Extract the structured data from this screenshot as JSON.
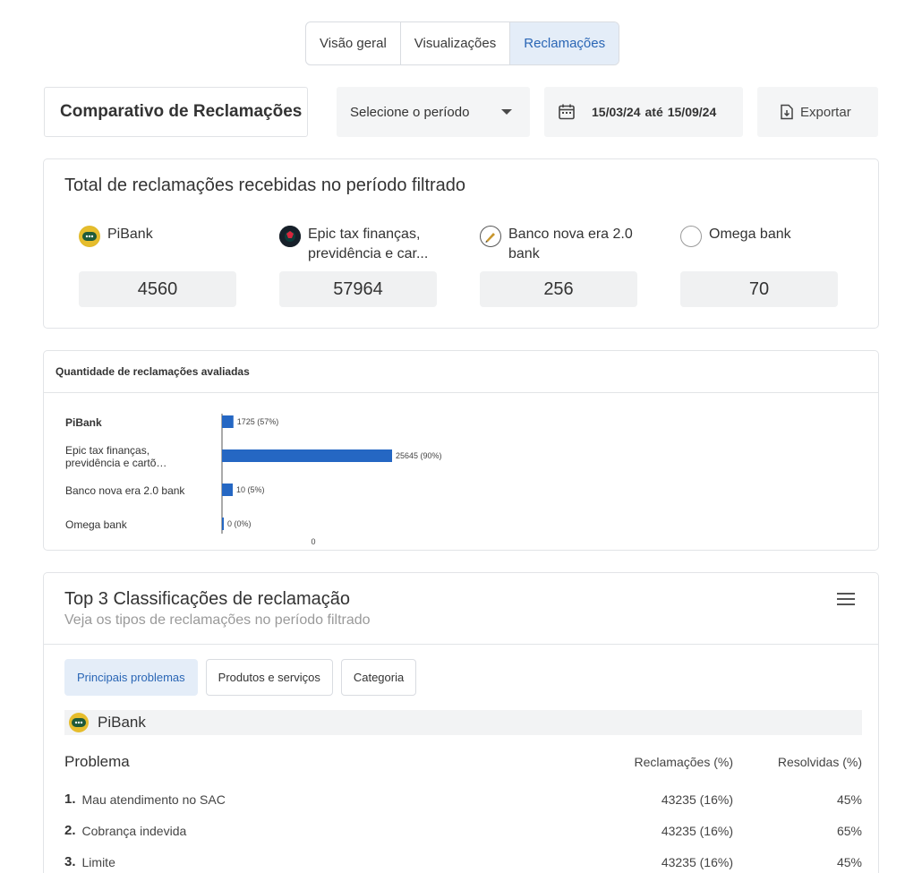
{
  "tabs": [
    {
      "label": "Visão geral",
      "active": false
    },
    {
      "label": "Visualizações",
      "active": false
    },
    {
      "label": "Reclamações",
      "active": true
    }
  ],
  "toolbar": {
    "title": "Comparativo de Reclamações",
    "period_placeholder": "Selecione o período",
    "date_from": "15/03/24",
    "date_separator": "até",
    "date_to": "15/09/24",
    "export_label": "Exportar"
  },
  "totals": {
    "title": "Total de reclamações recebidas no período filtrado",
    "banks": [
      {
        "name": "PiBank",
        "value": "4560",
        "logo": "pibank-logo"
      },
      {
        "name": "Epic tax finanças, previdência  e car...",
        "value": "57964",
        "logo": "epic-logo"
      },
      {
        "name": "Banco nova era 2.0 bank",
        "value": "256",
        "logo": "novaera-logo"
      },
      {
        "name": "Omega bank",
        "value": "70",
        "logo": "omega-logo"
      }
    ]
  },
  "chart_data": {
    "type": "bar",
    "orientation": "horizontal",
    "title": "Quantidade de reclamações avaliadas",
    "categories": [
      "PiBank",
      "Epic tax finanças, previdência  e cartões de...",
      "Banco nova era 2.0 bank",
      "Omega bank"
    ],
    "values": [
      1725,
      25645,
      10,
      0
    ],
    "data_labels": [
      "1725 (57%)",
      "25645 (90%)",
      "10 (5%)",
      "0 (0%)"
    ],
    "x_tick_labels": [
      "0"
    ],
    "bar_color": "#2567c3"
  },
  "top3": {
    "title": "Top 3 Classificações de reclamação",
    "subtitle": "Veja os tipos de reclamações no período filtrado",
    "menu_icon": "hamburger-menu-icon",
    "subtabs": [
      {
        "label": "Principais problemas",
        "active": true
      },
      {
        "label": "Produtos e serviços",
        "active": false
      },
      {
        "label": "Categoria",
        "active": false
      }
    ],
    "bank": "PiBank",
    "columns": {
      "problem": "Problema",
      "complaints": "Reclamações (%)",
      "resolved": "Resolvidas (%)"
    },
    "rows": [
      {
        "num": "1.",
        "problem": "Mau atendimento no SAC",
        "complaints": "43235 (16%)",
        "resolved": "45%"
      },
      {
        "num": "2.",
        "problem": "Cobrança indevida",
        "complaints": "43235 (16%)",
        "resolved": "65%"
      },
      {
        "num": "3.",
        "problem": "Limite",
        "complaints": "43235 (16%)",
        "resolved": "45%"
      }
    ]
  },
  "colors": {
    "accent": "#2a66b5",
    "bar": "#2567c3",
    "active_bg": "#e4edf8"
  }
}
